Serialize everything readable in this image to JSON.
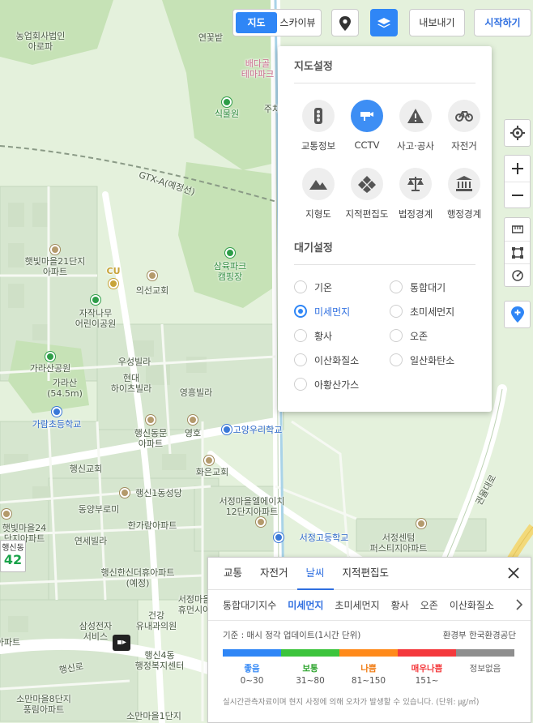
{
  "toolbar": {
    "maptype_map": "지도",
    "maptype_sky": "스카이뷰",
    "export_label": "내보내기",
    "start_label": "시작하기"
  },
  "map_labels": {
    "corp": "농업회사법인\n아로파",
    "yeon": "연꽃밭",
    "theme": "배다골\n테마파크",
    "plant": "식물원",
    "parking": "주차",
    "gtx": "GTX-A(예정선)",
    "hatbit21": "햇빛마을21단지\n아파트",
    "cu": "CU",
    "uiseon": "의선교회",
    "samyuk": "삼육파크\n캠핑장",
    "jajak": "자작나무\n어린이공원",
    "garasan_park": "가라산공원",
    "garasan": "가라산\n(54.5m)",
    "woosung": "우성빌라",
    "hyundai": "현대\n하이츠빌라",
    "yeongheung": "영흥빌라",
    "gara_school": "가람초등학교",
    "haengsin_dong": "행신동문\n아파트",
    "yeongho": "영호",
    "goyang_school": "고양우리학교",
    "haengsin_church": "행신교회",
    "hwaeun": "화은교회",
    "haengsin1": "행신1동성당",
    "dongyang": "동양부로미",
    "seojeong12": "서정마을엘에이치\n12단지아파트",
    "hatbit24": "햇빛마을24\n단지아파트",
    "hangaram": "한가람아파트",
    "yeonse": "연세빌라",
    "seojeong_school": "서정고등학교",
    "seojeong_center": "서정센텀\n퍼스티지아파트",
    "hanshin": "행신한신더휴아파트\n(예정)",
    "seojeong_maeul": "서정마을\n휴먼시아",
    "samsung": "삼성전자\n서비스",
    "geongang": "건강\n유내과의원",
    "haengsin4": "행신4동\n행정복지센터",
    "soman8": "소만마을8단지\n풍림아파트",
    "soman1": "소만마을1단지",
    "haengsin_ro": "행신로",
    "gwonyul": "권율대로",
    "apt_left": "아파트"
  },
  "pm_badge": {
    "area": "행신동",
    "value": "42"
  },
  "settings": {
    "map_title": "지도설정",
    "map_items": [
      {
        "label": "교통정보",
        "icon": "traffic-light-icon",
        "on": false
      },
      {
        "label": "CCTV",
        "icon": "cctv-icon",
        "on": true
      },
      {
        "label": "사고·공사",
        "icon": "warning-icon",
        "on": false
      },
      {
        "label": "자전거",
        "icon": "bicycle-icon",
        "on": false
      },
      {
        "label": "지형도",
        "icon": "mountain-icon",
        "on": false
      },
      {
        "label": "지적편집도",
        "icon": "cadastral-icon",
        "on": false
      },
      {
        "label": "법정경계",
        "icon": "scale-icon",
        "on": false
      },
      {
        "label": "행정경계",
        "icon": "government-icon",
        "on": false
      }
    ],
    "air_title": "대기설정",
    "air_items": [
      {
        "label": "기온",
        "selected": false
      },
      {
        "label": "통합대기",
        "selected": false
      },
      {
        "label": "미세먼지",
        "selected": true
      },
      {
        "label": "초미세먼지",
        "selected": false
      },
      {
        "label": "황사",
        "selected": false
      },
      {
        "label": "오존",
        "selected": false
      },
      {
        "label": "이산화질소",
        "selected": false
      },
      {
        "label": "일산화탄소",
        "selected": false
      },
      {
        "label": "아황산가스",
        "selected": false
      }
    ]
  },
  "bottom": {
    "tabs": [
      "교통",
      "자전거",
      "날씨",
      "지적편집도"
    ],
    "active_tab": "날씨",
    "subtabs": [
      "통합대기지수",
      "미세먼지",
      "초미세먼지",
      "황사",
      "오존",
      "이산화질소"
    ],
    "active_subtab": "미세먼지",
    "info_left": "기준 : 매시 정각 업데이트(1시간 단위)",
    "info_right": "환경부 한국환경공단",
    "grades": [
      {
        "name": "좋음",
        "range": "0~30",
        "color": "#2f86f6"
      },
      {
        "name": "보통",
        "range": "31~80",
        "color": "#3cc43c"
      },
      {
        "name": "나쁨",
        "range": "81~150",
        "color": "#ff8a1a"
      },
      {
        "name": "매우나쁨",
        "range": "151~",
        "color": "#f4393c"
      },
      {
        "name": "정보없음",
        "range": "",
        "color": "#8e8e8e"
      }
    ],
    "note": "실시간관측자료이며 현지 사정에 의해 오차가 발생할 수 있습니다. (단위: ㎍/㎥)"
  }
}
